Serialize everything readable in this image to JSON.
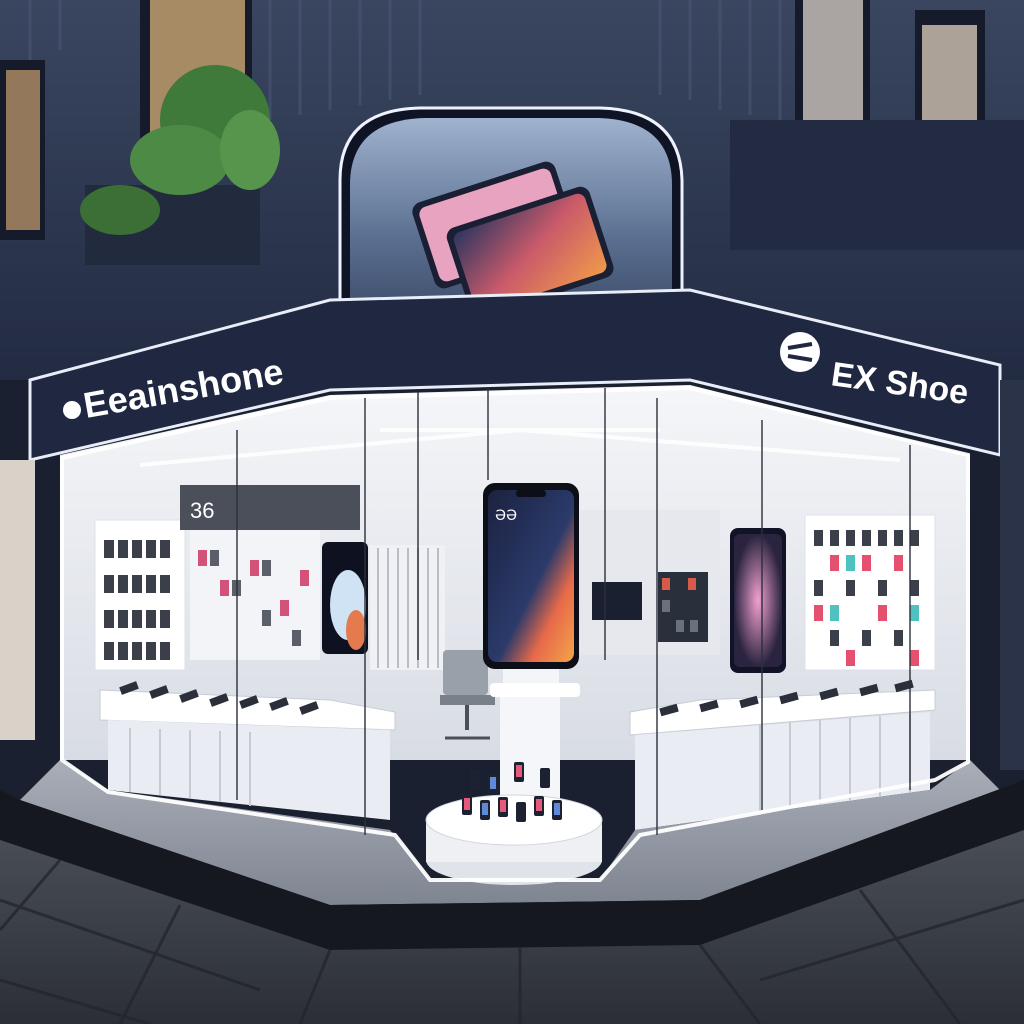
{
  "signs": {
    "left_name": "Eeainshone",
    "right_name": "EX  Shoe",
    "wall_number": "36",
    "phone_screen_text": "ƏƏ"
  },
  "colors": {
    "facade": "#2b3650",
    "facade_dark": "#1d253a",
    "sign_band": "#1f2840",
    "led": "#f4f7ff",
    "interior": "#e9ecf2",
    "floor": "#3a3f48",
    "pavement": "#3b3f45"
  }
}
